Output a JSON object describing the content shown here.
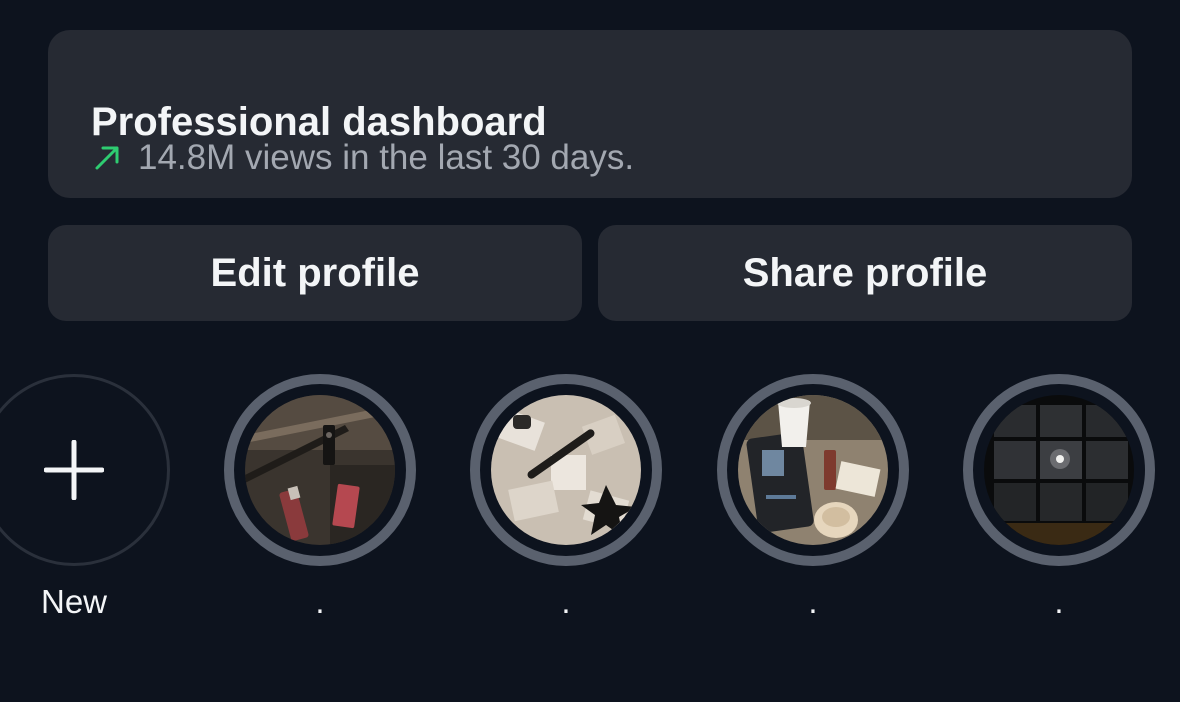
{
  "dashboard": {
    "title": "Professional dashboard",
    "trend_icon": "trending-up-arrow-icon",
    "trend_color": "#2ecc71",
    "views_text": "14.8M views in the last 30 days."
  },
  "buttons": {
    "edit_label": "Edit profile",
    "share_label": "Share profile"
  },
  "highlights": [
    {
      "label": "New",
      "icon": "plus-icon"
    },
    {
      "label": "."
    },
    {
      "label": "."
    },
    {
      "label": "."
    },
    {
      "label": "."
    }
  ],
  "colors": {
    "background": "#0d131e",
    "card": "#262a33",
    "ring": "#5a616e",
    "text": "#f3f5f7",
    "muted_text": "#a3a8b1"
  }
}
